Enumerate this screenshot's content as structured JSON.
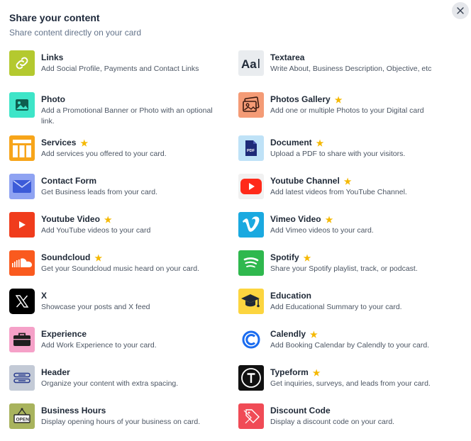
{
  "header": {
    "title": "Share your content",
    "subtitle": "Share content directly on your card"
  },
  "star_glyph": "★",
  "close_glyph": "×",
  "items": [
    {
      "name": "Links",
      "desc": "Add Social Profile, Payments and Contact Links",
      "premium": false,
      "icon": "link-icon",
      "color": "#b4c92f"
    },
    {
      "name": "Textarea",
      "desc": "Write About, Business Description, Objective, etc",
      "premium": false,
      "icon": "text-icon",
      "color": "#e9ecef"
    },
    {
      "name": "Photo",
      "desc": "Add a Promotional Banner or Photo with an optional link.",
      "premium": false,
      "icon": "photo-icon",
      "color": "#3ee5c8"
    },
    {
      "name": "Photos Gallery",
      "desc": "Add one or multiple Photos to your Digital card",
      "premium": true,
      "icon": "gallery-icon",
      "color": "#f49b76"
    },
    {
      "name": "Services",
      "desc": "Add services you offered to your card.",
      "premium": true,
      "icon": "services-icon",
      "color": "#f7a51a"
    },
    {
      "name": "Document",
      "desc": "Upload a PDF to share with your visitors.",
      "premium": true,
      "icon": "pdf-icon",
      "color": "#bfe2f7"
    },
    {
      "name": "Contact Form",
      "desc": "Get Business leads from your card.",
      "premium": false,
      "icon": "mail-icon",
      "color": "#8fa3f2"
    },
    {
      "name": "Youtube Channel",
      "desc": "Add latest videos from YouTube Channel.",
      "premium": true,
      "icon": "youtube-channel-icon",
      "color": "#f1f1f1"
    },
    {
      "name": "Youtube Video",
      "desc": "Add YouTube videos to your card",
      "premium": true,
      "icon": "youtube-video-icon",
      "color": "#f03c1c"
    },
    {
      "name": "Vimeo Video",
      "desc": "Add Vimeo videos to your card.",
      "premium": true,
      "icon": "vimeo-icon",
      "color": "#1aa9e0"
    },
    {
      "name": "Soundcloud",
      "desc": "Get your Soundcloud music heard on your card.",
      "premium": true,
      "icon": "soundcloud-icon",
      "color": "#fa5a1e"
    },
    {
      "name": "Spotify",
      "desc": "Share your Spotify playlist, track, or podcast.",
      "premium": true,
      "icon": "spotify-icon",
      "color": "#2fb84e"
    },
    {
      "name": "X",
      "desc": "Showcase your posts and X feed",
      "premium": false,
      "icon": "x-icon",
      "color": "#000000"
    },
    {
      "name": "Education",
      "desc": "Add Educational Summary to your card.",
      "premium": false,
      "icon": "graduation-cap-icon",
      "color": "#fcd53f"
    },
    {
      "name": "Experience",
      "desc": "Add Work Experience to your card.",
      "premium": false,
      "icon": "briefcase-icon",
      "color": "#f5a1c8"
    },
    {
      "name": "Calendly",
      "desc": "Add Booking Calendar by Calendly to your card.",
      "premium": true,
      "icon": "calendly-icon",
      "color": "#ffffff"
    },
    {
      "name": "Header",
      "desc": "Organize your content with extra spacing.",
      "premium": false,
      "icon": "header-icon",
      "color": "#c3cad6"
    },
    {
      "name": "Typeform",
      "desc": "Get inquiries, surveys, and leads from your card.",
      "premium": true,
      "icon": "typeform-icon",
      "color": "#111111"
    },
    {
      "name": "Business Hours",
      "desc": "Display opening hours of your business on card.",
      "premium": false,
      "icon": "open-sign-icon",
      "color": "#a8b35d"
    },
    {
      "name": "Discount Code",
      "desc": "Display a discount code on your card.",
      "premium": false,
      "icon": "discount-tag-icon",
      "color": "#f04b56"
    }
  ]
}
